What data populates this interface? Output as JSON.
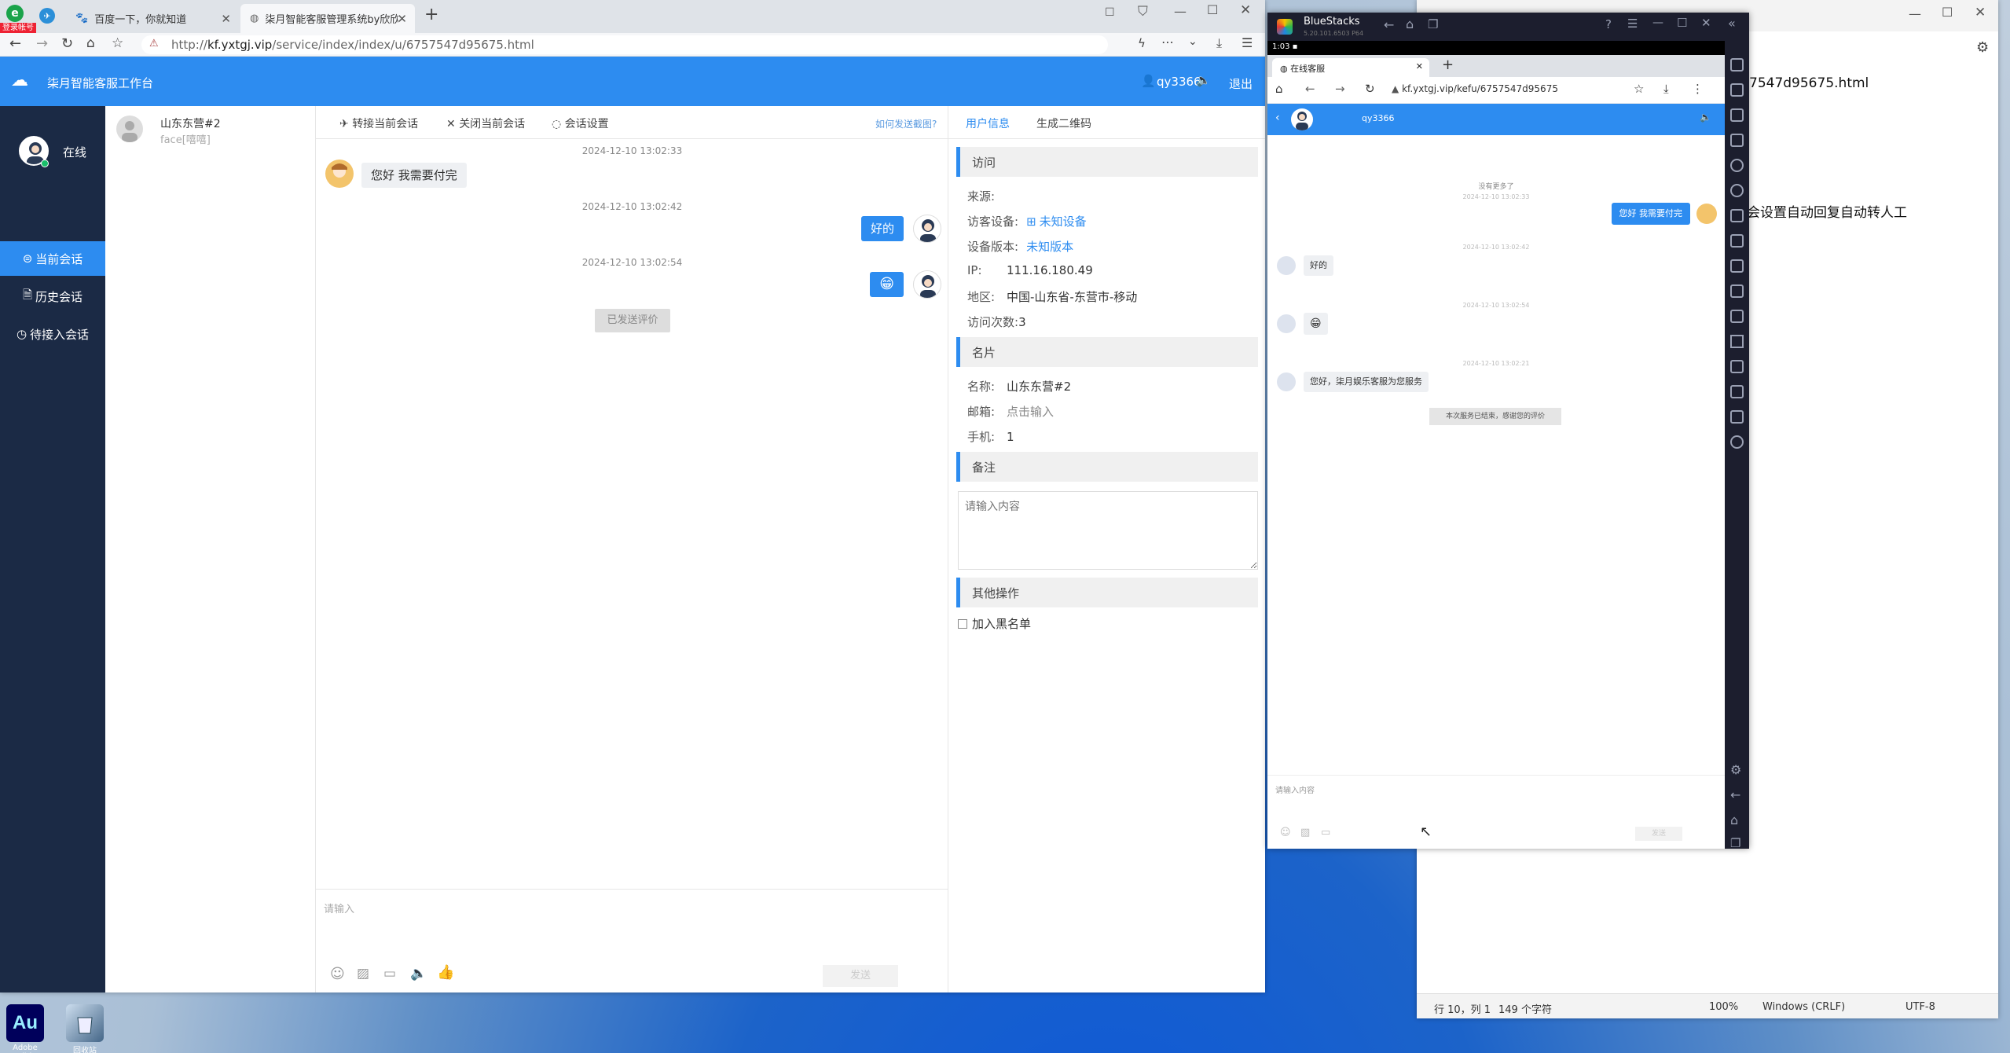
{
  "browser": {
    "profile_badge": "登录帐号",
    "tabs": [
      {
        "title": "百度一下，你就知道"
      },
      {
        "title": "柒月智能客服管理系统by欣欣"
      }
    ],
    "url_prefix": "http://",
    "url_domain": "kf.yxtgj.vip",
    "url_path": "/service/index/index/u/6757547d95675.html"
  },
  "app": {
    "title": "柒月智能客服工作台",
    "agent_name": "qy3366",
    "logout_label": "退出",
    "status_label": "在线",
    "nav": [
      {
        "label": "当前会话",
        "active": true
      },
      {
        "label": "历史会话",
        "active": false
      },
      {
        "label": "待接入会话",
        "active": false
      }
    ],
    "session": {
      "name": "山东东营#2",
      "last_message": "face[嘻嘻]"
    },
    "chat_toolbar": {
      "transfer": "转接当前会话",
      "close": "关闭当前会话",
      "settings": "会话设置",
      "screenshot_help": "如何发送截图?"
    },
    "messages": [
      {
        "time": "2024-12-10 13:02:33",
        "side": "left",
        "text": "您好 我需要付完"
      },
      {
        "time": "2024-12-10 13:02:42",
        "side": "right",
        "text": "好的"
      },
      {
        "time": "2024-12-10 13:02:54",
        "side": "right",
        "text": "😁"
      }
    ],
    "rating_sent": "已发送评价",
    "input_placeholder": "请输入",
    "send_label": "发送",
    "info_tabs": [
      {
        "label": "用户信息",
        "active": true
      },
      {
        "label": "生成二维码",
        "active": false
      }
    ],
    "visit": {
      "section": "访问",
      "source_label": "来源:",
      "device_label": "访客设备:",
      "device_value": "未知设备",
      "version_label": "设备版本:",
      "version_value": "未知版本",
      "ip_label": "IP:",
      "ip_value": "111.16.180.49",
      "region_label": "地区:",
      "region_value": "中国-山东省-东营市-移动",
      "visits_label": "访问次数:",
      "visits_value": "3"
    },
    "card": {
      "section": "名片",
      "name_label": "名称:",
      "name_value": "山东东营#2",
      "email_label": "邮箱:",
      "email_value": "点击输入",
      "phone_label": "手机:",
      "phone_value": "1"
    },
    "note": {
      "section": "备注",
      "placeholder": "请输入内容"
    },
    "other": {
      "section": "其他操作",
      "blacklist_label": "加入黑名单"
    }
  },
  "bluestacks": {
    "title": "BlueStacks",
    "version": "5.20.101.6503 P64",
    "time": "1:03",
    "tab_title": "在线客服",
    "url": "kf.yxtgj.vip/kefu/6757547d95675",
    "agent": "qy3366",
    "no_more": "没有更多了",
    "messages": [
      {
        "time": "2024-12-10 13:02:33",
        "side": "right",
        "text": "您好 我需要付完"
      },
      {
        "time": "2024-12-10 13:02:42",
        "side": "left",
        "text": "好的"
      },
      {
        "time": "2024-12-10 13:02:54",
        "side": "left",
        "text": "😁"
      },
      {
        "time": "2024-12-10 13:02:21",
        "side": "left",
        "text": "您好，柒月娱乐客服为您服务"
      }
    ],
    "ended_notice": "本次服务已结束，感谢您的评价",
    "input_placeholder": "请输入内容",
    "send_label": "发送"
  },
  "notepad": {
    "filename_fragment": "7547d95675.html",
    "content_fragment": "会设置自动回复自动转人工",
    "status": {
      "position": "行 10，列 1",
      "chars": "149 个字符",
      "zoom": "100%",
      "eol": "Windows (CRLF)",
      "encoding": "UTF-8"
    }
  },
  "desktop": {
    "icons": [
      {
        "label": "Adobe Audition",
        "short": "Au"
      },
      {
        "label": "回收站"
      }
    ]
  },
  "colors": {
    "accent": "#2d8cf0",
    "sidebar": "#1b2a45",
    "bluestacks_chrome": "#1c1e2e"
  }
}
